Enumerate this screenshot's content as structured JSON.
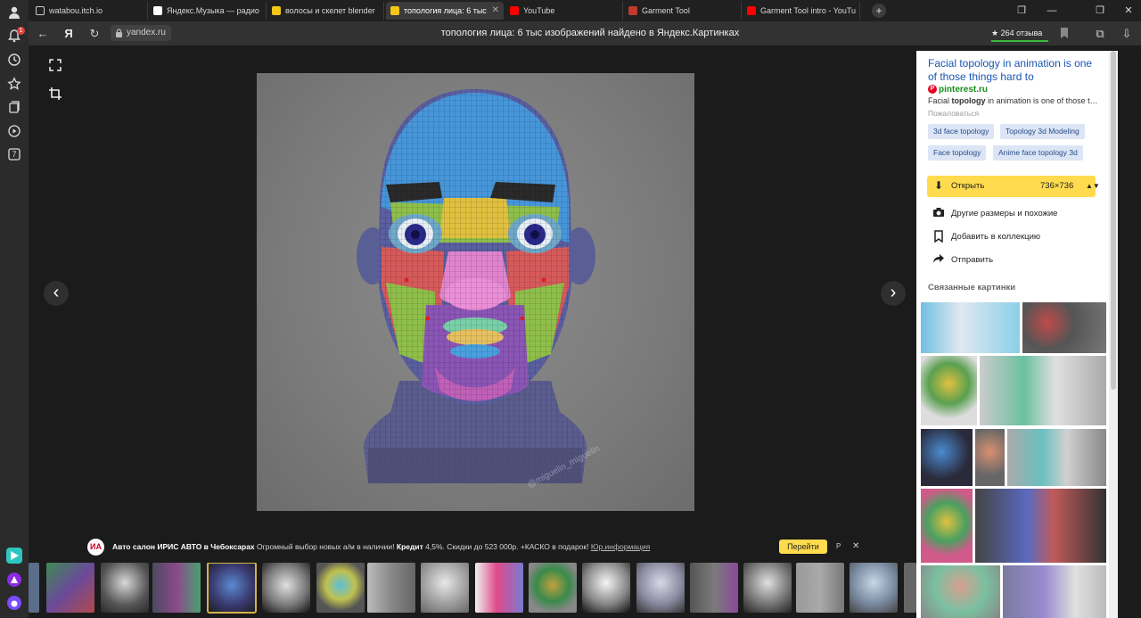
{
  "browser": {
    "tabs": [
      {
        "title": "watabou.itch.io",
        "favicon_color": "#3a3a3a"
      },
      {
        "title": "Яндекс.Музыка — радио",
        "favicon_color": "#ffffff"
      },
      {
        "title": "волосы и скелет blender",
        "favicon_color": "#f5c518"
      },
      {
        "title": "топология лица: 6 тыс",
        "favicon_color": "#f5c518"
      },
      {
        "title": "YouTube",
        "favicon_color": "#ff0000"
      },
      {
        "title": "Garment Tool",
        "favicon_color": "#c0392b"
      },
      {
        "title": "Garment Tool intro - YouTu",
        "favicon_color": "#ff0000"
      }
    ],
    "active_tab_index": 3,
    "new_tab_glyph": "+",
    "address": {
      "domain": "yandex.ru",
      "page_title": "топология лица: 6 тыс изображений найдено в Яндекс.Картинках",
      "reviews": "★ 264 отзыва"
    },
    "notification_count": "1",
    "rail_badge_number": "7"
  },
  "viewer": {
    "close_glyph": "✕",
    "watermark": "@miguelin_miguelin",
    "ad": {
      "logo_text": "ИА",
      "title": "Авто салон ИРИС АВТО в Чебоксарах",
      "text_before": "Огромный выбор новых а/м в наличии!",
      "credit": "Кредит",
      "text_after": "4,5%. Скидки до 523 000р. +КАСКО в подарок!",
      "legal": "Юр.информация",
      "button": "Перейти",
      "marker": "Р",
      "close": "✕"
    }
  },
  "panel": {
    "source_title": "Facial topology in animation is one of those things hard to",
    "source_domain": "pinterest.ru",
    "snippet_before": "Facial ",
    "snippet_bold": "topology",
    "snippet_after": " in animation is one of those things hard to",
    "complain": "Пожаловаться",
    "tags": [
      "3d face topology",
      "Topology 3d Modeling",
      "Face topology",
      "Anime face topology 3d"
    ],
    "open_label": "Открыть",
    "open_size": "736×736",
    "actions": [
      {
        "label": "Другие размеры и похожие",
        "icon": "camera-icon"
      },
      {
        "label": "Добавить в коллекцию",
        "icon": "bookmark-icon"
      },
      {
        "label": "Отправить",
        "icon": "share-icon"
      }
    ],
    "related_heading": "Связанные картинки"
  }
}
